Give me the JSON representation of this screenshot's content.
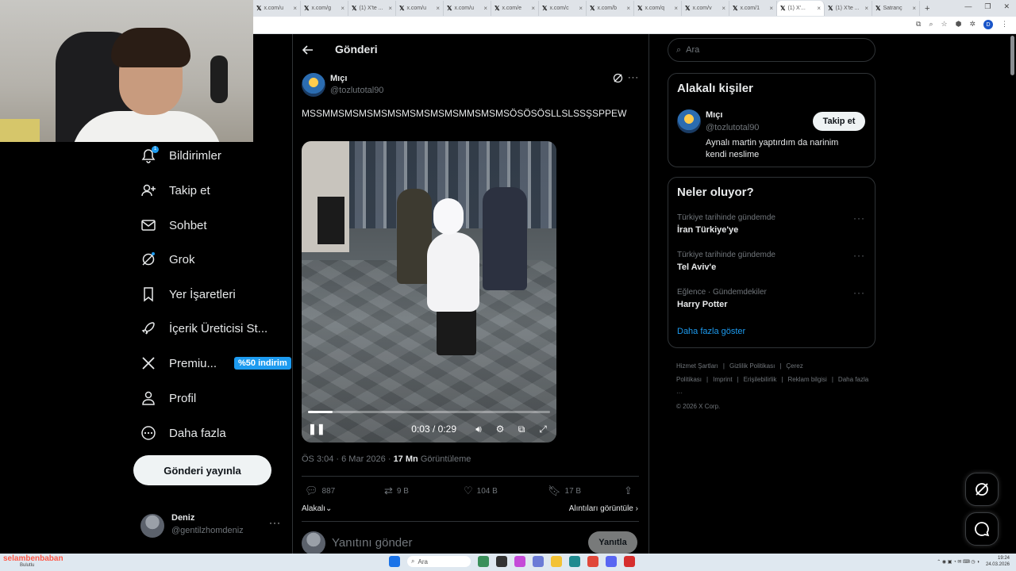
{
  "browser": {
    "tabs": [
      {
        "label": "x.com/u"
      },
      {
        "label": "x.com/g"
      },
      {
        "label": "(1) X'te ..."
      },
      {
        "label": "x.com/u"
      },
      {
        "label": "x.com/u"
      },
      {
        "label": "x.com/e"
      },
      {
        "label": "x.com/c"
      },
      {
        "label": "x.com/b"
      },
      {
        "label": "x.com/q"
      },
      {
        "label": "x.com/v"
      },
      {
        "label": "x.com/1"
      },
      {
        "label": "(1) X'..."
      },
      {
        "label": "(1) X'te ..."
      },
      {
        "label": "Satranç"
      }
    ],
    "active_tab_index": 11,
    "profile_initial": "D"
  },
  "nav": {
    "items": [
      {
        "label": "Bildirimler",
        "icon": "bell-icon",
        "badge": "1"
      },
      {
        "label": "Takip et",
        "icon": "person-add-icon"
      },
      {
        "label": "Sohbet",
        "icon": "mail-icon"
      },
      {
        "label": "Grok",
        "icon": "grok-icon"
      },
      {
        "label": "Yer İşaretleri",
        "icon": "bookmark-icon"
      },
      {
        "label": "İçerik Üreticisi St...",
        "icon": "rocket-icon"
      },
      {
        "label": "Premiu...",
        "icon": "x-logo-icon",
        "promo": "%50 indirim"
      },
      {
        "label": "Profil",
        "icon": "person-icon"
      },
      {
        "label": "Daha fazla",
        "icon": "more-circle-icon"
      }
    ],
    "post_button": "Gönderi yayınla",
    "account": {
      "name": "Deniz",
      "handle": "@gentilzhomdeniz"
    }
  },
  "post": {
    "header_title": "Gönderi",
    "author_name": "Mıçı",
    "author_handle": "@tozlutotal90",
    "text": "MSSMMSMSMSMSMSMSMSMSMSMMSMSMSÖSÖSÖSLLSLSSŞSPPEW",
    "video": {
      "current_time": "0:03",
      "duration": "0:29",
      "progress": 0.1
    },
    "time": "ÖS 3:04 · 6 Mar 2026 · ",
    "views_count": "17 Mn",
    "views_label": "Görüntüleme",
    "replies": "887",
    "reposts": "9 B",
    "likes": "104 B",
    "bookmarks": "17 B",
    "related_label": "Alakalı",
    "quotes_label": "Alıntıları görüntüle",
    "reply_placeholder": "Yanıtını gönder",
    "reply_button": "Yanıtla"
  },
  "sidebar": {
    "search_placeholder": "Ara",
    "related": {
      "title": "Alakalı kişiler",
      "name": "Mıçı",
      "handle": "@tozlutotal90",
      "bio": "Aynalı martin yaptırdım da narinim kendi neslime",
      "follow_label": "Takip et"
    },
    "trends": {
      "title": "Neler oluyor?",
      "items": [
        {
          "context": "Türkiye tarihinde gündemde",
          "name": "İran Türkiye'ye"
        },
        {
          "context": "Türkiye tarihinde gündemde",
          "name": "Tel Aviv'e"
        },
        {
          "context": "Eğlence · Gündemdekiler",
          "name": "Harry Potter"
        }
      ],
      "show_more": "Daha fazla göster"
    },
    "footer": [
      "Hizmet Şartları",
      "|",
      "Gizlilik Politikası",
      "|",
      "Çerez Politikası",
      "|",
      "Imprint",
      "|",
      "Erişilebilirlik",
      "|",
      "Reklam bilgisi",
      "|",
      "Daha fazla ···",
      "© 2026 X Corp."
    ]
  },
  "taskbar": {
    "search_placeholder": "Ara",
    "time": "19:24",
    "date": "24.03.2026",
    "overlay_name": "selambenbaban",
    "overlay_sub": "Bulutlu"
  },
  "colors": {
    "accent": "#1d9bf0",
    "background": "#000000",
    "muted": "#71767b"
  }
}
